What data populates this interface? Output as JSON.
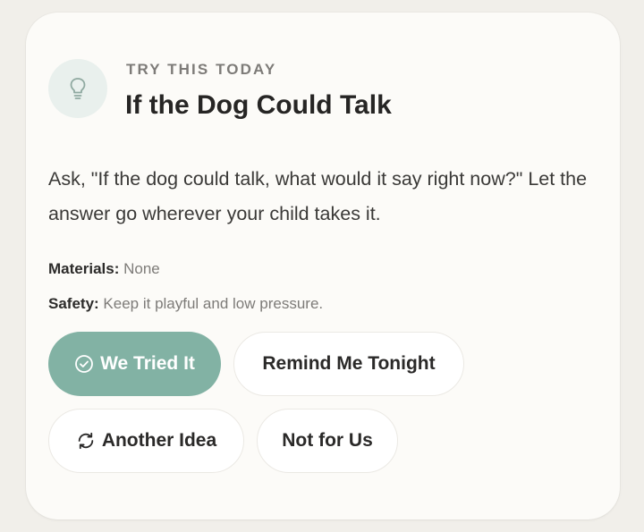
{
  "card": {
    "eyebrow": "TRY THIS TODAY",
    "title": "If the Dog Could Talk",
    "description": "Ask, \"If the dog could talk, what would it say right now?\" Let the answer go wherever your child takes it.",
    "materials_label": "Materials:",
    "materials_value": "None",
    "safety_label": "Safety:",
    "safety_value": "Keep it playful and low pressure."
  },
  "actions": {
    "tried_label": "We Tried It",
    "remind_label": "Remind Me Tonight",
    "another_label": "Another Idea",
    "not_label": "Not for Us"
  },
  "icons": {
    "header": "lightbulb-icon",
    "tried": "check-circle-icon",
    "another": "refresh-icon"
  },
  "colors": {
    "accent": "#82b2a4",
    "icon_bg": "#e9f0ed",
    "card_bg": "#fcfbf8",
    "page_bg": "#f1efea"
  }
}
